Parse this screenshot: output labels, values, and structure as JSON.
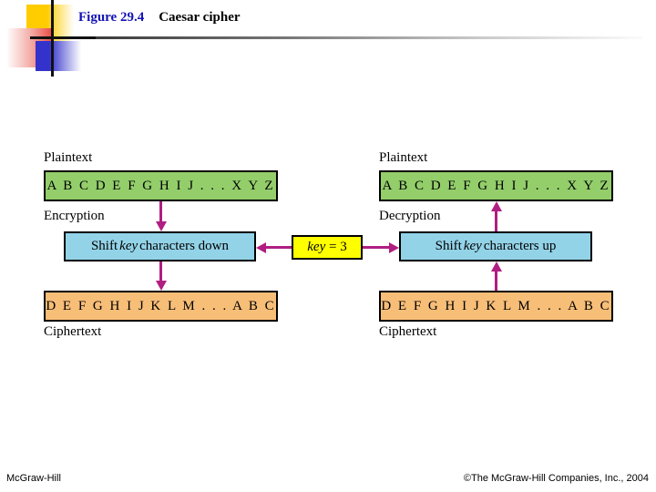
{
  "title": {
    "figure_number": "Figure 29.4",
    "caption": "Caesar cipher"
  },
  "colors": {
    "figure_number_color": "#1414B4",
    "plaintext_box": "#93CE6B",
    "ciphertext_box": "#F7BE78",
    "shift_box": "#93D3E8",
    "key_box": "#FFFF00",
    "arrow": "#B01E82",
    "deco_yellow": "#FFCC00",
    "deco_red": "#E8453C",
    "deco_blue": "#3333CC"
  },
  "encryption_side": {
    "plaintext_label": "Plaintext",
    "plaintext_alphabet": "A B C D E F G H I J . . . X Y Z",
    "process_label": "Encryption",
    "shift_prefix": "Shift",
    "shift_keyword": "key",
    "shift_suffix": "characters down",
    "ciphertext_alphabet": "D E F G H I J K L M . . . A B C",
    "ciphertext_label": "Ciphertext"
  },
  "decryption_side": {
    "plaintext_label": "Plaintext",
    "plaintext_alphabet": "A B C D E F G H I J . . . X Y Z",
    "process_label": "Decryption",
    "shift_prefix": "Shift",
    "shift_keyword": "key",
    "shift_suffix": "characters up",
    "ciphertext_alphabet": "D E F G H I J K L M . . . A B C",
    "ciphertext_label": "Ciphertext"
  },
  "key": {
    "label": "key",
    "equals": "=",
    "value": "3"
  },
  "footer": {
    "left": "McGraw-Hill",
    "right": "©The McGraw-Hill Companies, Inc., 2004"
  }
}
